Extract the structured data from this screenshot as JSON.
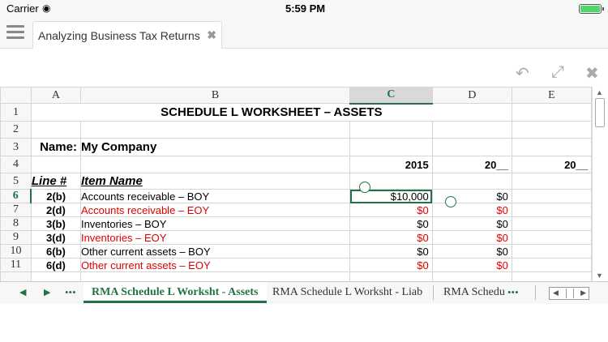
{
  "status": {
    "carrier": "Carrier",
    "time": "5:59 PM"
  },
  "tab": {
    "title": "Analyzing Business Tax Returns"
  },
  "columns": [
    "A",
    "B",
    "C",
    "D",
    "E"
  ],
  "rows": {
    "r1": {
      "num": "1",
      "title": "SCHEDULE L WORKSHEET – ASSETS"
    },
    "r2": {
      "num": "2"
    },
    "r3": {
      "num": "3",
      "label": "Name:",
      "value": "My Company"
    },
    "r4": {
      "num": "4",
      "c": "2015",
      "d": "20__",
      "e": "20__"
    },
    "r5": {
      "num": "5",
      "a": "Line #",
      "b": "Item Name"
    },
    "r6": {
      "num": "6",
      "a": "2(b)",
      "b": "Accounts receivable – BOY",
      "c": "$10,000",
      "d": "$0"
    },
    "r7": {
      "num": "7",
      "a": "2(d)",
      "b": "Accounts receivable – EOY",
      "c": "$0",
      "d": "$0"
    },
    "r8": {
      "num": "8",
      "a": "3(b)",
      "b": "Inventories – BOY",
      "c": "$0",
      "d": "$0"
    },
    "r9": {
      "num": "9",
      "a": "3(d)",
      "b": "Inventories – EOY",
      "c": "$0",
      "d": "$0"
    },
    "r10": {
      "num": "10",
      "a": "6(b)",
      "b": "Other current assets – BOY",
      "c": "$0",
      "d": "$0"
    },
    "r11": {
      "num": "11",
      "a": "6(d)",
      "b": "Other current assets – EOY",
      "c": "$0",
      "d": "$0"
    }
  },
  "sheets": {
    "active": "RMA Schedule L Worksht - Assets",
    "second": "RMA Schedule L Worksht - Liab",
    "third": "RMA Schedu",
    "more": "•••"
  },
  "colors": {
    "accent": "#217346",
    "negative_red": "#e00000"
  }
}
